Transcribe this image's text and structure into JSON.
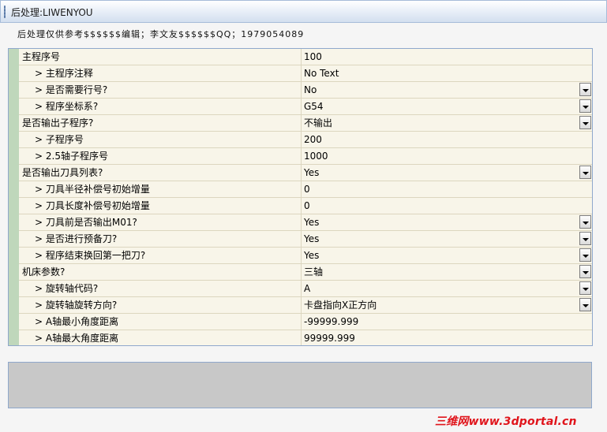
{
  "window": {
    "title": "后处理:LIWENYOU"
  },
  "header_note": "后处理仅供参考$$$$$$编辑；李文友$$$$$$QQ；1979054089",
  "grid": {
    "rows": [
      {
        "name": "主程序号",
        "value": "100",
        "child": false,
        "dropdown": false
      },
      {
        "name": "> 主程序注释",
        "value": "No Text",
        "child": true,
        "dropdown": false
      },
      {
        "name": "> 是否需要行号?",
        "value": "No",
        "child": true,
        "dropdown": true
      },
      {
        "name": "> 程序坐标系?",
        "value": "G54",
        "child": true,
        "dropdown": true
      },
      {
        "name": "是否输出子程序?",
        "value": "不输出",
        "child": false,
        "dropdown": true
      },
      {
        "name": "> 子程序号",
        "value": "200",
        "child": true,
        "dropdown": false
      },
      {
        "name": "> 2.5轴子程序号",
        "value": "1000",
        "child": true,
        "dropdown": false
      },
      {
        "name": "是否输出刀具列表?",
        "value": "Yes",
        "child": false,
        "dropdown": true
      },
      {
        "name": "> 刀具半径补偿号初始增量",
        "value": "0",
        "child": true,
        "dropdown": false
      },
      {
        "name": "> 刀具长度补偿号初始增量",
        "value": "0",
        "child": true,
        "dropdown": false
      },
      {
        "name": "> 刀具前是否输出M01?",
        "value": "Yes",
        "child": true,
        "dropdown": true
      },
      {
        "name": "> 是否进行预备刀?",
        "value": "Yes",
        "child": true,
        "dropdown": true
      },
      {
        "name": "> 程序结束换回第一把刀?",
        "value": "Yes",
        "child": true,
        "dropdown": true
      },
      {
        "name": "机床参数?",
        "value": "三轴",
        "child": false,
        "dropdown": true
      },
      {
        "name": "> 旋转轴代码?",
        "value": "A",
        "child": true,
        "dropdown": true
      },
      {
        "name": "> 旋转轴旋转方向?",
        "value": "卡盘指向X正方向",
        "child": true,
        "dropdown": true
      },
      {
        "name": "> A轴最小角度距离",
        "value": "-99999.999",
        "child": true,
        "dropdown": false
      },
      {
        "name": "> A轴最大角度距离",
        "value": "99999.999",
        "child": true,
        "dropdown": false
      }
    ]
  },
  "watermark": "三维网www.3dportal.cn",
  "colors": {
    "gutter": "#bfd7bb",
    "grid_bg": "#f8f5e9",
    "panel": "#c8c8c8",
    "watermark": "#e0141b"
  }
}
